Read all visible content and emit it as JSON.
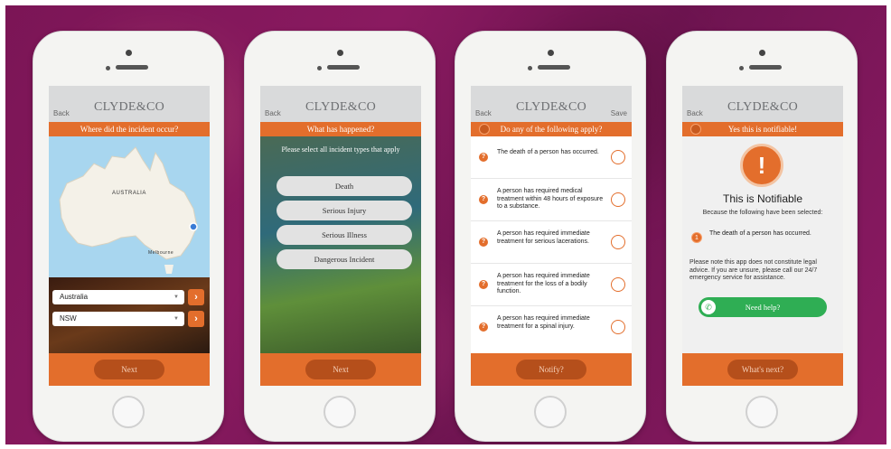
{
  "brand": {
    "logo": "CLYDE&CO",
    "accent": "#e36e2c",
    "background": "#8a1a60"
  },
  "phone1": {
    "back": "Back",
    "bar": "Where did the incident occur?",
    "map_label": "AUSTRALIA",
    "map_city": "Melbourne",
    "country_select": "Australia",
    "state_select": "NSW",
    "next": "Next"
  },
  "phone2": {
    "back": "Back",
    "bar": "What has happened?",
    "instruction": "Please select all incident types that apply",
    "options": [
      "Death",
      "Serious Injury",
      "Serious Illness",
      "Dangerous Incident"
    ],
    "next": "Next"
  },
  "phone3": {
    "back": "Back",
    "save": "Save",
    "bar": "Do any of the following apply?",
    "items": [
      "The death of a person has occurred.",
      "A person has required medical treatment within 48 hours of exposure to a substance.",
      "A person has required immediate treatment for serious lacerations.",
      "A person has required immediate treatment for the loss of a bodily function.",
      "A person has required immediate treatment for a spinal injury."
    ],
    "notify": "Notify?"
  },
  "phone4": {
    "back": "Back",
    "bar": "Yes this is notifiable!",
    "title": "This is Notifiable",
    "subtitle": "Because the following have been selected:",
    "item_number": "1",
    "item": "The death of a person has occurred.",
    "note": "Please note this app does not constitute legal advice. If you are unsure, please call our 24/7 emergency service for assistance.",
    "help": "Need help?",
    "next": "What's next?"
  }
}
